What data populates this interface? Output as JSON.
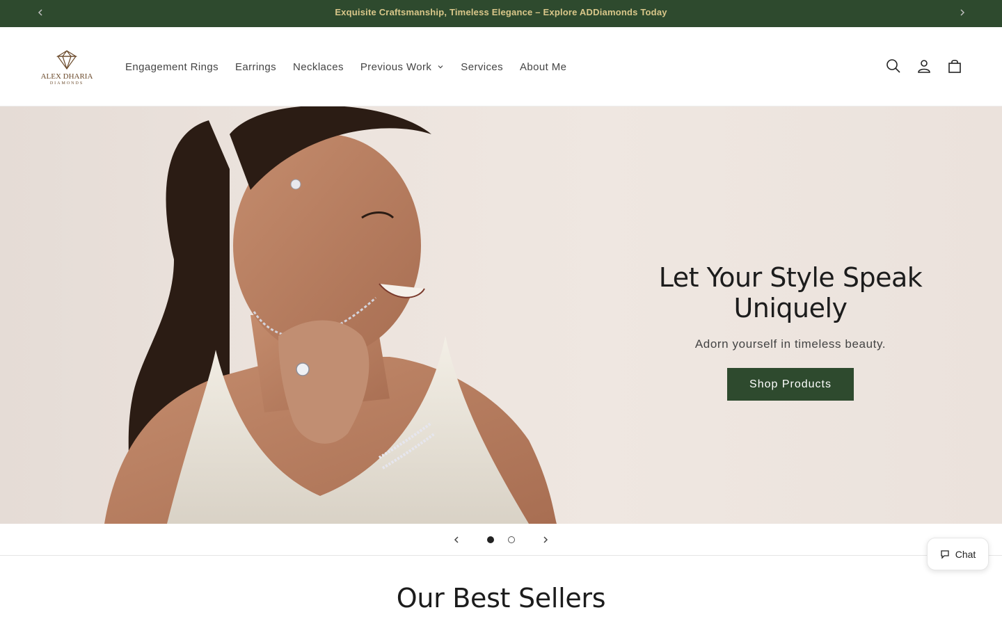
{
  "announcement": {
    "text": "Exquisite Craftsmanship, Timeless Elegance – Explore ADDiamonds Today",
    "prev_icon": "chevron-left-icon",
    "next_icon": "chevron-right-icon"
  },
  "header": {
    "logo": {
      "line1": "ALEX DHARIA",
      "line2": "DIAMONDS"
    },
    "nav": [
      {
        "label": "Engagement Rings"
      },
      {
        "label": "Earrings"
      },
      {
        "label": "Necklaces"
      },
      {
        "label": "Previous Work",
        "has_dropdown": true
      },
      {
        "label": "Services"
      },
      {
        "label": "About Me"
      }
    ],
    "icons": [
      "search-icon",
      "account-icon",
      "cart-icon"
    ]
  },
  "hero": {
    "title": "Let Your Style Speak Uniquely",
    "subtitle": "Adorn yourself in timeless beauty.",
    "button": "Shop Products",
    "slides_total": 2,
    "active_slide": 1
  },
  "best_sellers": {
    "title": "Our Best Sellers"
  },
  "chat": {
    "label": "Chat"
  },
  "colors": {
    "brand_green": "#2e4a2e",
    "announce_text": "#d9c78a",
    "logo_brown": "#6b4a2b"
  }
}
